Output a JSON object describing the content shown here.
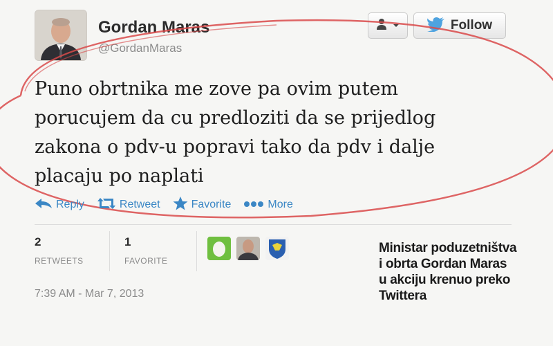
{
  "tweet": {
    "author_name": "Gordan Maras",
    "author_handle": "@GordanMaras",
    "text": "Puno obrtnika me zove pa ovim putem\nporucujem da cu predloziti da se prijedlog\nzakona o pdv-u popravi tako da pdv i dalje\nplacaju po naplati",
    "timestamp": "7:39 AM - Mar 7, 2013"
  },
  "header_buttons": {
    "user_dropdown_icon": "user-icon",
    "follow_label": "Follow",
    "follow_icon": "twitter-bird-icon"
  },
  "actions": {
    "reply": "Reply",
    "retweet": "Retweet",
    "favorite": "Favorite",
    "more": "More"
  },
  "stats": {
    "retweets_count": "2",
    "retweets_label": "RETWEETS",
    "favorites_count": "1",
    "favorites_label": "FAVORITE"
  },
  "caption": {
    "line1": "Ministar poduzetništva",
    "line2": "i obrta Gordan Maras",
    "line3": "u akciju krenuo preko",
    "line4": "Twittera"
  },
  "colors": {
    "accent": "#3b87c5",
    "highlight_ellipse": "#d94a4a",
    "twitter_blue": "#4ea3e0"
  }
}
